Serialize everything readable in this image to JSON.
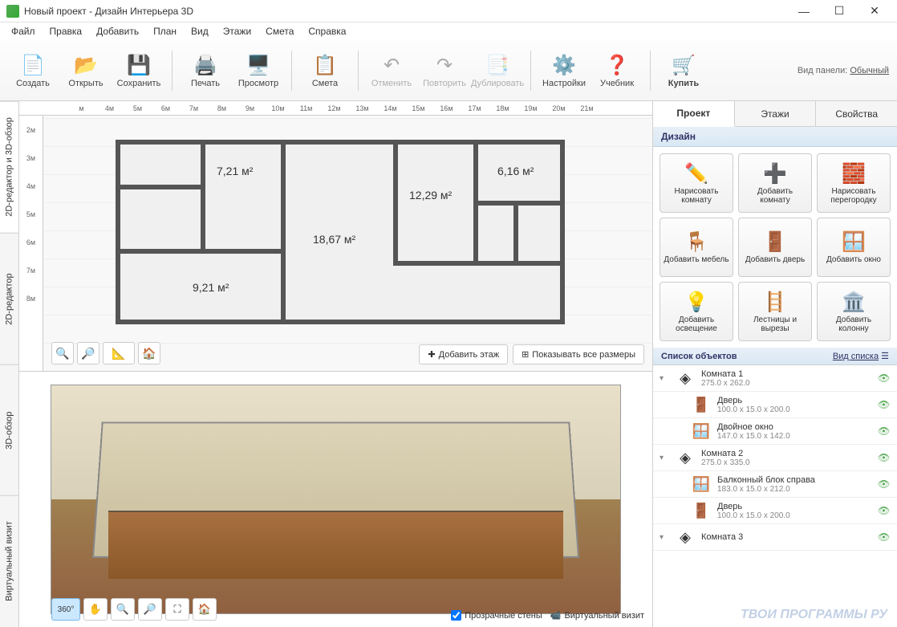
{
  "window": {
    "title": "Новый проект - Дизайн Интерьера 3D"
  },
  "menu": {
    "items": [
      "Файл",
      "Правка",
      "Добавить",
      "План",
      "Вид",
      "Этажи",
      "Смета",
      "Справка"
    ]
  },
  "toolbar": {
    "create": "Создать",
    "open": "Открыть",
    "save": "Сохранить",
    "print": "Печать",
    "preview": "Просмотр",
    "estimate": "Смета",
    "undo": "Отменить",
    "redo": "Повторить",
    "duplicate": "Дублировать",
    "settings": "Настройки",
    "tutorial": "Учебник",
    "buy": "Купить",
    "panel_label": "Вид панели:",
    "panel_mode": "Обычный"
  },
  "vtabs": {
    "combo": "2D-редактор и 3D-обзор",
    "editor2d": "2D-редактор",
    "view3d": "3D-обзор",
    "virtual": "Виртуальный визит"
  },
  "ruler_h": [
    "м",
    "4м",
    "5м",
    "6м",
    "7м",
    "8м",
    "9м",
    "10м",
    "11м",
    "12м",
    "13м",
    "14м",
    "15м",
    "16м",
    "17м",
    "18м",
    "19м",
    "20м",
    "21м",
    ""
  ],
  "ruler_v": [
    "2м",
    "3м",
    "4м",
    "5м",
    "6м",
    "7м",
    "8м"
  ],
  "rooms": {
    "r1": "7,21 м²",
    "r2": "18,67 м²",
    "r3": "12,29 м²",
    "r4": "6,16 м²",
    "r5": "9,21 м²"
  },
  "plan2d": {
    "add_floor": "Добавить этаж",
    "show_sizes": "Показывать все размеры"
  },
  "view3d": {
    "transparent_walls": "Прозрачные стены",
    "virtual_visit": "Виртуальный визит"
  },
  "rtabs": {
    "project": "Проект",
    "floors": "Этажи",
    "properties": "Свойства"
  },
  "design_section": "Дизайн",
  "design_buttons": {
    "draw_room": "Нарисовать комнату",
    "add_room": "Добавить комнату",
    "draw_partition": "Нарисовать перегородку",
    "add_furniture": "Добавить мебель",
    "add_door": "Добавить дверь",
    "add_window": "Добавить окно",
    "add_lighting": "Добавить освещение",
    "stairs": "Лестницы и вырезы",
    "add_column": "Добавить колонну"
  },
  "objects": {
    "header": "Список объектов",
    "view_mode": "Вид списка",
    "items": [
      {
        "name": "Комната 1",
        "dim": "275.0 x 262.0",
        "type": "room",
        "expandable": true
      },
      {
        "name": "Дверь",
        "dim": "100.0 x 15.0 x 200.0",
        "type": "door",
        "child": true
      },
      {
        "name": "Двойное окно",
        "dim": "147.0 x 15.0 x 142.0",
        "type": "window",
        "child": true
      },
      {
        "name": "Комната 2",
        "dim": "275.0 x 335.0",
        "type": "room",
        "expandable": true
      },
      {
        "name": "Балконный блок справа",
        "dim": "183.0 x 15.0 x 212.0",
        "type": "window",
        "child": true
      },
      {
        "name": "Дверь",
        "dim": "100.0 x 15.0 x 200.0",
        "type": "door",
        "child": true
      },
      {
        "name": "Комната 3",
        "dim": "",
        "type": "room",
        "expandable": true
      }
    ]
  },
  "watermark": "ТВОИ ПРОГРАММЫ РУ"
}
